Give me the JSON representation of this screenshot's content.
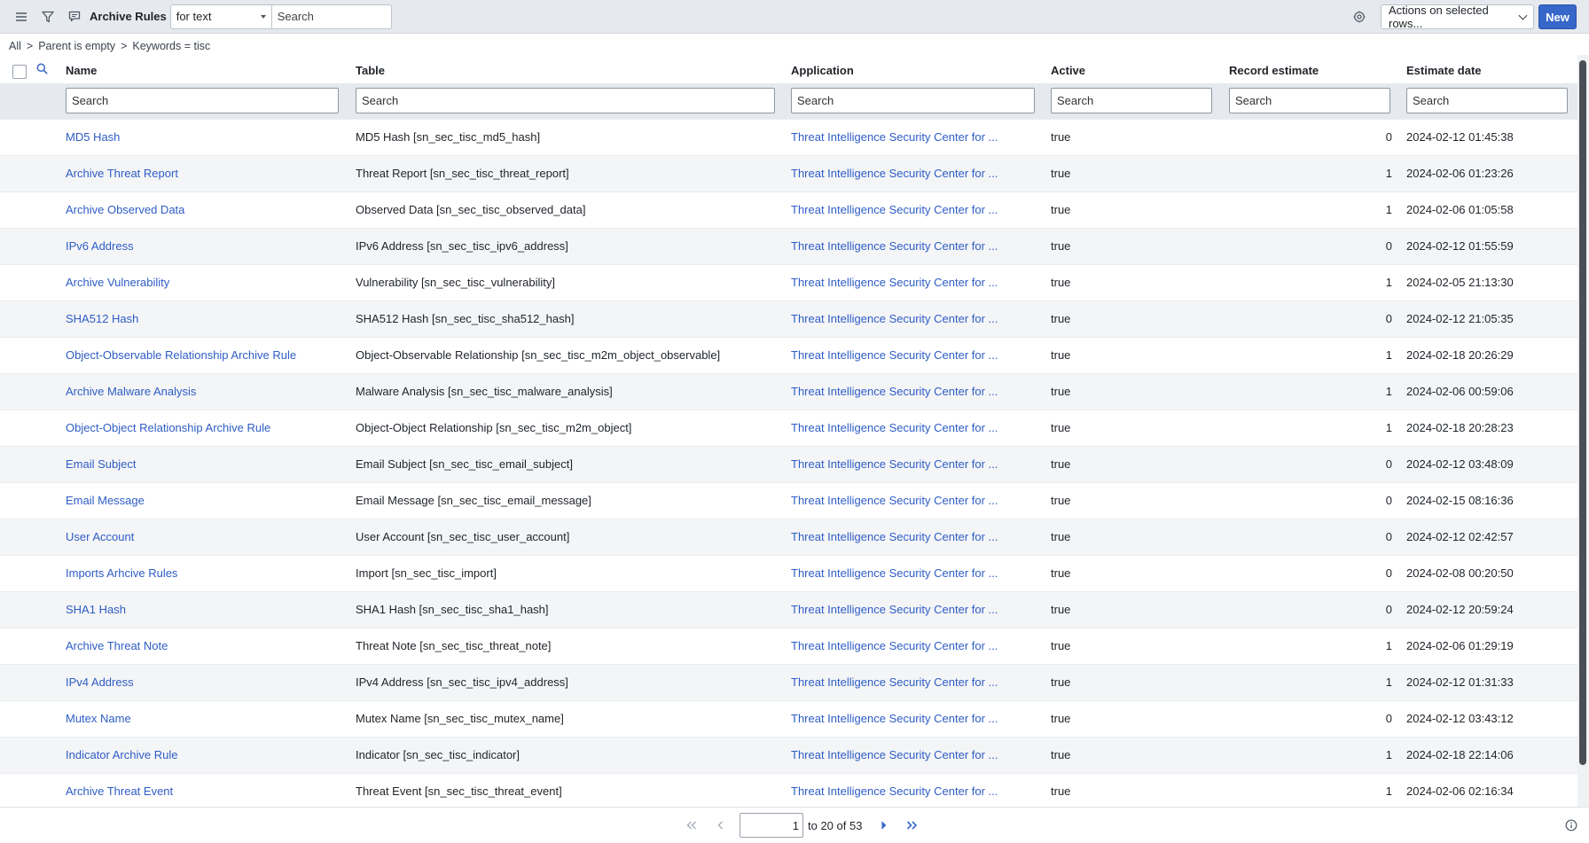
{
  "header": {
    "title": "Archive Rules",
    "filter_select": "for text",
    "search_placeholder": "Search",
    "actions_select": "Actions on selected rows...",
    "new_label": "New"
  },
  "breadcrumb": {
    "items": [
      "All",
      "Parent is empty",
      "Keywords = tisc"
    ],
    "separator": ">"
  },
  "columns": [
    "Name",
    "Table",
    "Application",
    "Active",
    "Record estimate",
    "Estimate date"
  ],
  "column_search_placeholder": "Search",
  "rows": [
    {
      "name": "MD5 Hash",
      "table": "MD5 Hash [sn_sec_tisc_md5_hash]",
      "application": "Threat Intelligence Security Center for ...",
      "active": "true",
      "estimate": "0",
      "date": "2024-02-12 01:45:38"
    },
    {
      "name": "Archive Threat Report",
      "table": "Threat Report [sn_sec_tisc_threat_report]",
      "application": "Threat Intelligence Security Center for ...",
      "active": "true",
      "estimate": "1",
      "date": "2024-02-06 01:23:26"
    },
    {
      "name": "Archive Observed Data",
      "table": "Observed Data [sn_sec_tisc_observed_data]",
      "application": "Threat Intelligence Security Center for ...",
      "active": "true",
      "estimate": "1",
      "date": "2024-02-06 01:05:58"
    },
    {
      "name": "IPv6 Address",
      "table": "IPv6 Address [sn_sec_tisc_ipv6_address]",
      "application": "Threat Intelligence Security Center for ...",
      "active": "true",
      "estimate": "0",
      "date": "2024-02-12 01:55:59"
    },
    {
      "name": "Archive Vulnerability",
      "table": "Vulnerability [sn_sec_tisc_vulnerability]",
      "application": "Threat Intelligence Security Center for ...",
      "active": "true",
      "estimate": "1",
      "date": "2024-02-05 21:13:30"
    },
    {
      "name": "SHA512 Hash",
      "table": "SHA512 Hash [sn_sec_tisc_sha512_hash]",
      "application": "Threat Intelligence Security Center for ...",
      "active": "true",
      "estimate": "0",
      "date": "2024-02-12 21:05:35"
    },
    {
      "name": "Object-Observable Relationship Archive Rule",
      "table": "Object-Observable Relationship [sn_sec_tisc_m2m_object_observable]",
      "application": "Threat Intelligence Security Center for ...",
      "active": "true",
      "estimate": "1",
      "date": "2024-02-18 20:26:29"
    },
    {
      "name": "Archive Malware Analysis",
      "table": "Malware Analysis [sn_sec_tisc_malware_analysis]",
      "application": "Threat Intelligence Security Center for ...",
      "active": "true",
      "estimate": "1",
      "date": "2024-02-06 00:59:06"
    },
    {
      "name": "Object-Object Relationship Archive Rule",
      "table": "Object-Object Relationship [sn_sec_tisc_m2m_object]",
      "application": "Threat Intelligence Security Center for ...",
      "active": "true",
      "estimate": "1",
      "date": "2024-02-18 20:28:23"
    },
    {
      "name": "Email Subject",
      "table": "Email Subject [sn_sec_tisc_email_subject]",
      "application": "Threat Intelligence Security Center for ...",
      "active": "true",
      "estimate": "0",
      "date": "2024-02-12 03:48:09"
    },
    {
      "name": "Email Message",
      "table": "Email Message [sn_sec_tisc_email_message]",
      "application": "Threat Intelligence Security Center for ...",
      "active": "true",
      "estimate": "0",
      "date": "2024-02-15 08:16:36"
    },
    {
      "name": "User Account",
      "table": "User Account [sn_sec_tisc_user_account]",
      "application": "Threat Intelligence Security Center for ...",
      "active": "true",
      "estimate": "0",
      "date": "2024-02-12 02:42:57"
    },
    {
      "name": "Imports Arhcive Rules",
      "table": "Import [sn_sec_tisc_import]",
      "application": "Threat Intelligence Security Center for ...",
      "active": "true",
      "estimate": "0",
      "date": "2024-02-08 00:20:50"
    },
    {
      "name": "SHA1 Hash",
      "table": "SHA1 Hash [sn_sec_tisc_sha1_hash]",
      "application": "Threat Intelligence Security Center for ...",
      "active": "true",
      "estimate": "0",
      "date": "2024-02-12 20:59:24"
    },
    {
      "name": "Archive Threat Note",
      "table": "Threat Note [sn_sec_tisc_threat_note]",
      "application": "Threat Intelligence Security Center for ...",
      "active": "true",
      "estimate": "1",
      "date": "2024-02-06 01:29:19"
    },
    {
      "name": "IPv4 Address",
      "table": "IPv4 Address [sn_sec_tisc_ipv4_address]",
      "application": "Threat Intelligence Security Center for ...",
      "active": "true",
      "estimate": "1",
      "date": "2024-02-12 01:31:33"
    },
    {
      "name": "Mutex Name",
      "table": "Mutex Name [sn_sec_tisc_mutex_name]",
      "application": "Threat Intelligence Security Center for ...",
      "active": "true",
      "estimate": "0",
      "date": "2024-02-12 03:43:12"
    },
    {
      "name": "Indicator Archive Rule",
      "table": "Indicator [sn_sec_tisc_indicator]",
      "application": "Threat Intelligence Security Center for ...",
      "active": "true",
      "estimate": "1",
      "date": "2024-02-18 22:14:06"
    },
    {
      "name": "Archive Threat Event",
      "table": "Threat Event [sn_sec_tisc_threat_event]",
      "application": "Threat Intelligence Security Center for ...",
      "active": "true",
      "estimate": "1",
      "date": "2024-02-06 02:16:34"
    }
  ],
  "pagination": {
    "page_value": "1",
    "range_text": "to 20 of 53"
  },
  "icons": {
    "menu": "hamburger-menu-icon",
    "filter": "funnel-icon",
    "context": "chat-bubble-icon",
    "settings": "gear-icon",
    "search": "search-icon",
    "info": "info-icon"
  },
  "colors": {
    "link": "#2e5dc5",
    "primary_button": "#3767c8",
    "header_bg": "#e6e9ee"
  }
}
